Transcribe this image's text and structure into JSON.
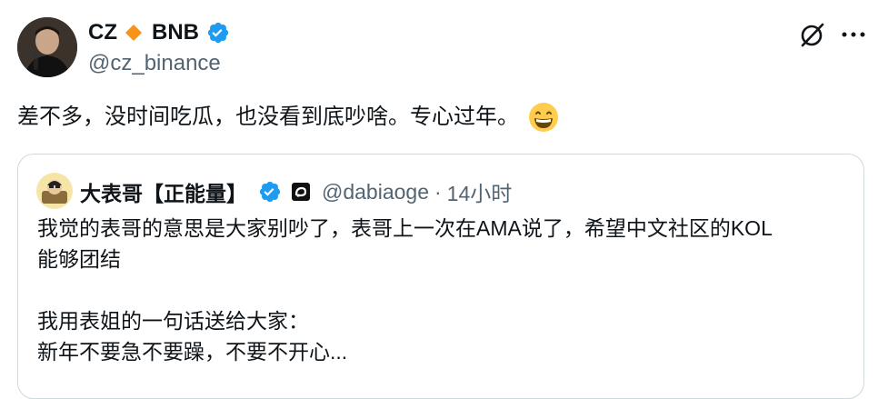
{
  "tweet": {
    "author": {
      "name_part1": "CZ",
      "name_part2": "BNB",
      "handle": "@cz_binance",
      "name_icon": "orange-diamond-icon",
      "verified_icon": "verified-badge-icon"
    },
    "text": "差不多，没时间吃瓜，也没看到底吵啥。专心过年。",
    "text_emoji": "grinning-face-icon",
    "actions": [
      "grok-icon",
      "more-icon"
    ]
  },
  "quote": {
    "author": {
      "name": "大表哥【正能量】",
      "handle": "@dabiaoge",
      "separator": "·",
      "time": "14小时",
      "verified_icon": "verified-badge-icon",
      "affiliate_icon": "affiliate-badge-icon"
    },
    "lines": [
      "我觉的表哥的意思是大家别吵了，表哥上一次在AMA说了，希望中文社区的KOL",
      "能够团结",
      "",
      "我用表姐的一句话送给大家：",
      "新年不要急不要躁，不要不开心..."
    ]
  },
  "colors": {
    "text_primary": "#0f1419",
    "text_secondary": "#536471",
    "verified_blue": "#1d9bf0",
    "bnb_orange": "#f7931a",
    "border": "#cfd9de"
  }
}
